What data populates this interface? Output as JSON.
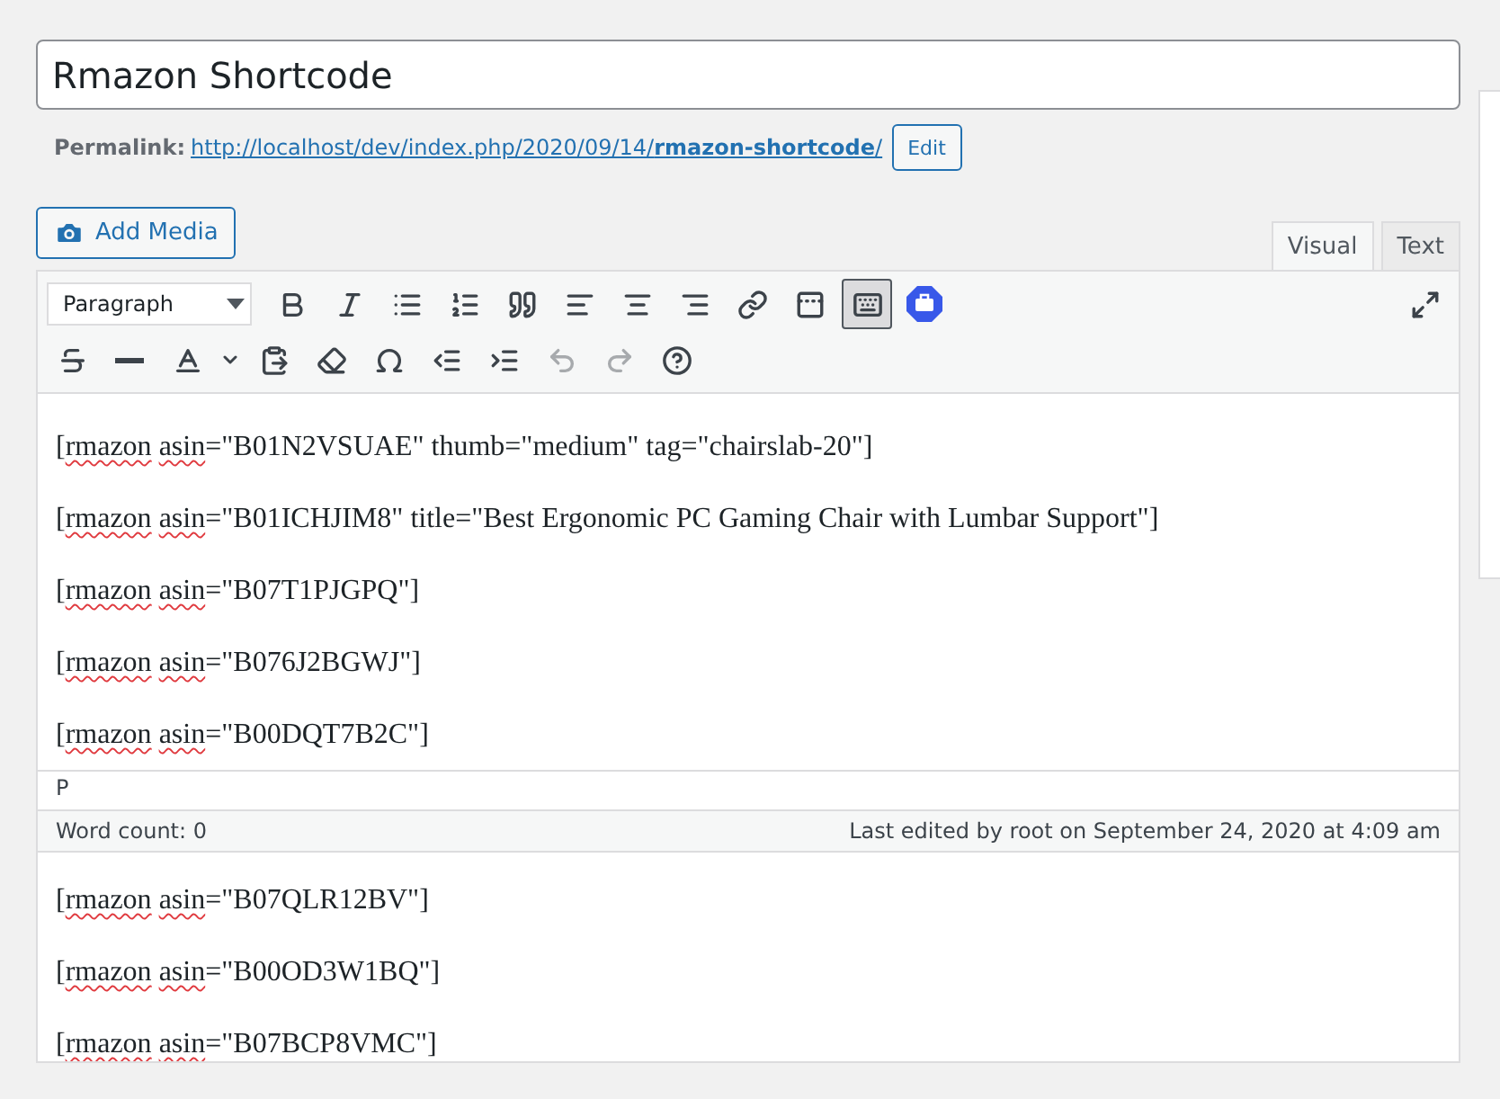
{
  "title_field": {
    "value": "Rmazon Shortcode"
  },
  "permalink": {
    "label": "Permalink:",
    "url_base": "http://localhost/dev/index.php/2020/09/14/",
    "slug": "rmazon-shortcode",
    "url_end": "/",
    "edit": "Edit"
  },
  "add_media": "Add Media",
  "editor_tabs": [
    {
      "label": "Visual",
      "selected": true
    },
    {
      "label": "Text",
      "selected": false
    }
  ],
  "toolbar": {
    "format": "Paragraph",
    "row_1": [
      {
        "pressed": false,
        "disabled": false
      },
      {
        "pressed": false,
        "disabled": false
      },
      {
        "pressed": false,
        "disabled": false
      },
      {
        "pressed": false,
        "disabled": false
      },
      {
        "pressed": false,
        "disabled": false
      },
      {
        "pressed": false,
        "disabled": false
      },
      {
        "pressed": false,
        "disabled": false
      },
      {
        "pressed": false,
        "disabled": false
      },
      {
        "pressed": false,
        "disabled": false
      },
      {
        "pressed": false,
        "disabled": false
      },
      {
        "pressed": true,
        "disabled": false
      },
      {
        "pressed": false,
        "disabled": false
      }
    ],
    "row_2": [
      {
        "pressed": false,
        "disabled": false
      },
      {
        "pressed": false,
        "disabled": false
      },
      {
        "pressed": false,
        "disabled": false
      },
      {
        "pressed": false,
        "disabled": false
      },
      {
        "pressed": false,
        "disabled": false
      },
      {
        "pressed": false,
        "disabled": false
      },
      {
        "pressed": false,
        "disabled": false
      },
      {
        "pressed": false,
        "disabled": false
      },
      {
        "pressed": false,
        "disabled": true
      },
      {
        "pressed": false,
        "disabled": true
      },
      {
        "pressed": false,
        "disabled": false
      }
    ]
  },
  "content": [
    {
      "segments": [
        {
          "text": "[",
          "misspelled": false
        },
        {
          "text": "rmazon",
          "misspelled": true
        },
        {
          "text": " asin",
          "misspelled": true
        },
        {
          "text": "=\"B01N2VSUAE\" thumb=\"medium\" tag=\"chairslab-20\"]",
          "misspelled": false
        }
      ]
    },
    {
      "segments": [
        {
          "text": "[",
          "misspelled": false
        },
        {
          "text": "rmazon",
          "misspelled": true
        },
        {
          "text": " asin",
          "misspelled": true
        },
        {
          "text": "=\"B01ICHJIM8\" title=\"Best Ergonomic PC Gaming Chair with Lumbar Support\"]",
          "misspelled": false
        }
      ]
    },
    {
      "segments": [
        {
          "text": "[",
          "misspelled": false
        },
        {
          "text": "rmazon",
          "misspelled": true
        },
        {
          "text": " asin",
          "misspelled": true
        },
        {
          "text": "=\"B07T1PJGPQ\"]",
          "misspelled": false
        }
      ]
    },
    {
      "segments": [
        {
          "text": "[",
          "misspelled": false
        },
        {
          "text": "rmazon",
          "misspelled": true
        },
        {
          "text": " asin",
          "misspelled": true
        },
        {
          "text": "=\"B076J2BGWJ\"]",
          "misspelled": false
        }
      ]
    },
    {
      "segments": [
        {
          "text": "[",
          "misspelled": false
        },
        {
          "text": "rmazon",
          "misspelled": true
        },
        {
          "text": " asin",
          "misspelled": true
        },
        {
          "text": "=\"B00DQT7B2C\"]",
          "misspelled": false
        }
      ]
    }
  ],
  "path": "P",
  "status_bar": {
    "word_count": "Word count: 0",
    "last_edited": "Last edited by root on September 24, 2020 at 4:09 am"
  },
  "below_content": [
    {
      "segments": [
        {
          "text": "[",
          "misspelled": false
        },
        {
          "text": "rmazon",
          "misspelled": true
        },
        {
          "text": " asin",
          "misspelled": true
        },
        {
          "text": "=\"B07QLR12BV\"]",
          "misspelled": false
        }
      ]
    },
    {
      "segments": [
        {
          "text": "[",
          "misspelled": false
        },
        {
          "text": "rmazon",
          "misspelled": true
        },
        {
          "text": " asin",
          "misspelled": true
        },
        {
          "text": "=\"B00OD3W1BQ\"]",
          "misspelled": false
        }
      ]
    },
    {
      "segments": [
        {
          "text": "[",
          "misspelled": false
        },
        {
          "text": "rmazon",
          "misspelled": true
        },
        {
          "text": " asin",
          "misspelled": true
        },
        {
          "text": "=\"B07BCP8VMC\"]",
          "misspelled": false
        }
      ]
    }
  ]
}
